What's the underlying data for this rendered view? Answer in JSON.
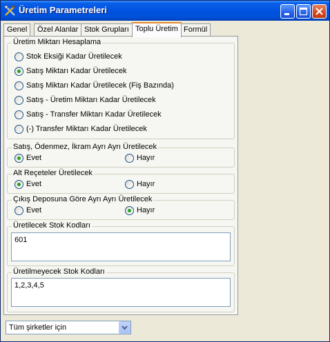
{
  "window": {
    "title": "Üretim Parametreleri",
    "colors": {
      "titlebar": "#0053e1",
      "active_tab_accent": "#e68b2c",
      "radio_dot": "#21a121",
      "close_button": "#d8461d"
    }
  },
  "tabs": [
    "Genel",
    "Özel Alanlar",
    "Stok Grupları",
    "Toplu Üretim",
    "Formül"
  ],
  "active_tab": "Toplu Üretim",
  "uretim_miktari": {
    "title": "Üretim Miktarı Hesaplama",
    "options": [
      {
        "label": "Stok Eksiği Kadar Üretilecek",
        "selected": false
      },
      {
        "label": "Satış Miktarı Kadar Üretilecek",
        "selected": true
      },
      {
        "label": "Satış Miktarı Kadar Üretilecek (Fiş Bazında)",
        "selected": false
      },
      {
        "label": "Satış - Üretim Miktarı Kadar Üretilecek",
        "selected": false
      },
      {
        "label": "Satış - Transfer Miktarı Kadar Üretilecek",
        "selected": false
      },
      {
        "label": "(-) Transfer Miktarı Kadar Üretilecek",
        "selected": false
      }
    ]
  },
  "satis_odenmez": {
    "title": "Satış, Ödenmez, İkram Ayrı Ayrı Üretilecek",
    "yes": "Evet",
    "no": "Hayır",
    "selected": "yes"
  },
  "alt_receteler": {
    "title": "Alt Reçeteler Üretilecek",
    "yes": "Evet",
    "no": "Hayır",
    "selected": "yes"
  },
  "cikis_deposu": {
    "title": "Çıkış Deposuna Göre Ayrı Ayrı Üretilecek",
    "yes": "Evet",
    "no": "Hayır",
    "selected": "no"
  },
  "uretilecek": {
    "title": "Üretilecek Stok Kodları",
    "value": "601"
  },
  "uretilmeyecek": {
    "title": "Üretilmeyecek Stok Kodları",
    "value": "1,2,3,4,5"
  },
  "company_select": {
    "value": "Tüm şirketler için",
    "icon": "chevron-down-icon"
  },
  "titlebar_icons": [
    "tools-icon",
    "minimize-icon",
    "maximize-icon",
    "close-icon"
  ]
}
